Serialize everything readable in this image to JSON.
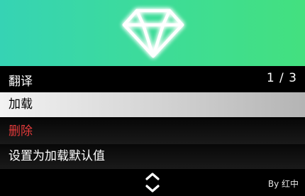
{
  "banner": {
    "gradient_start": "#36d3b4",
    "gradient_end": "#43e07f",
    "logo_icon": "diamond-icon"
  },
  "header": {
    "title": "翻译",
    "counter": "1 / 3"
  },
  "menu": {
    "items": [
      {
        "label": "加载",
        "selected": true
      },
      {
        "label": "删除",
        "color": "#e43b3b"
      },
      {
        "label": "设置为加载默认值"
      }
    ]
  },
  "footer": {
    "scroll_icon": "up-down-chevrons-icon",
    "credit": "By 红中"
  }
}
